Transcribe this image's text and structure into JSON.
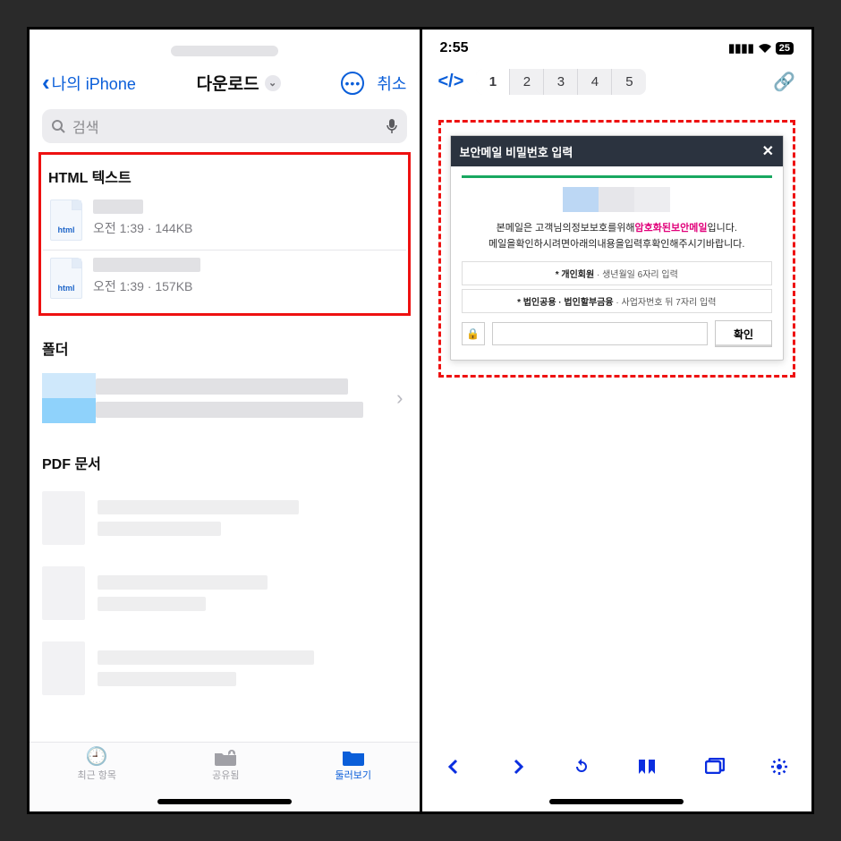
{
  "left": {
    "back_label": "나의 iPhone",
    "title": "다운로드",
    "cancel": "취소",
    "search_placeholder": "검색",
    "section_html": "HTML 텍스트",
    "files": [
      {
        "badge": "html",
        "meta": "오전 1:39 · 144KB"
      },
      {
        "badge": "html",
        "meta": "오전 1:39 · 157KB"
      }
    ],
    "section_folder": "폴더",
    "section_pdf": "PDF 문서",
    "tabs": {
      "recent": "최근 항목",
      "shared": "공유됨",
      "browse": "둘러보기"
    }
  },
  "right": {
    "time": "2:55",
    "battery": "25",
    "pages": [
      "1",
      "2",
      "3",
      "4",
      "5"
    ],
    "modal": {
      "title": "보안메일 비밀번호 입력",
      "msg_1a": "본메일은 고객님의정보보호를위해",
      "msg_1b": "암호화된보안메일",
      "msg_1c": "입니다.",
      "msg_2": "메일을확인하시려면아래의내용을입력후확인해주시기바랍니다.",
      "hint1_b": "* 개인회원",
      "hint1_t": " · 생년월일 6자리 입력",
      "hint2_b": "* 법인공용 · 법인할부금융",
      "hint2_t": " · 사업자번호 뒤 7자리 입력",
      "confirm": "확인"
    }
  }
}
